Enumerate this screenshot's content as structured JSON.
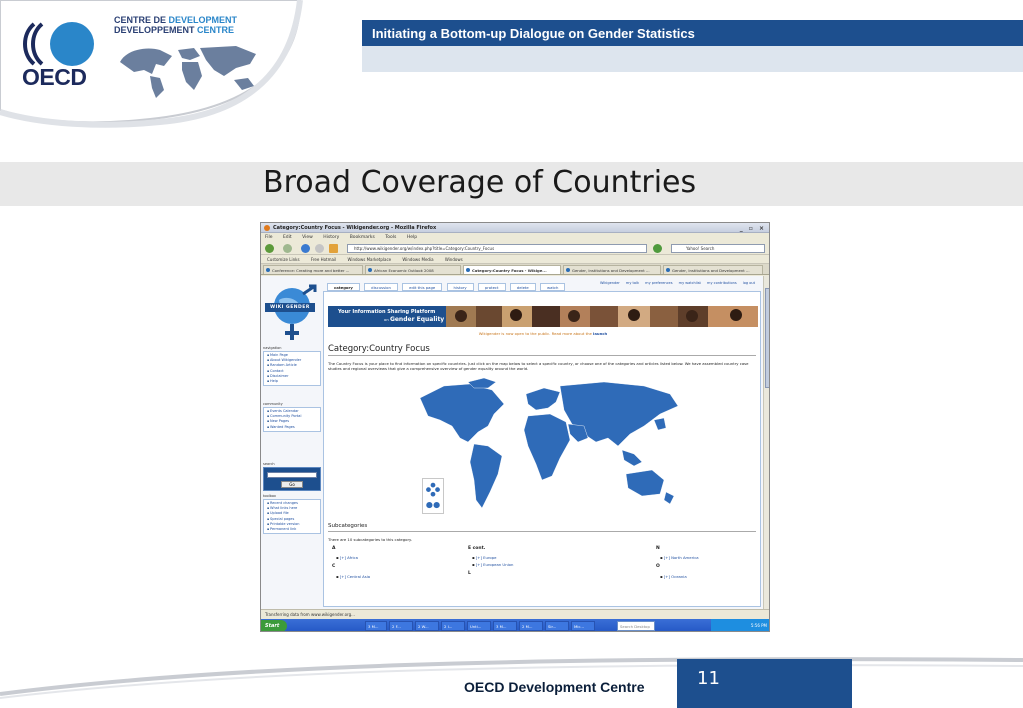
{
  "header": {
    "logo_word": "OECD",
    "centre_line1_a": "CENTRE DE ",
    "centre_line1_b": "DEVELOPMENT",
    "centre_line2_a": "DEVELOPPEMENT ",
    "centre_line2_b": "CENTRE",
    "banner_title": "Initiating a Bottom-up Dialogue on Gender Statistics"
  },
  "slide": {
    "title": "Broad Coverage of Countries"
  },
  "browser": {
    "window_title": "Category:Country Focus - Wikigender.org - Mozilla Firefox",
    "window_buttons": "_ ▫ ×",
    "menu": [
      "File",
      "Edit",
      "View",
      "History",
      "Bookmarks",
      "Tools",
      "Help"
    ],
    "url": "http://www.wikigender.org/w/index.php?title=Category:Country_Focus",
    "search_placeholder": "Yahoo! Search",
    "bookmarks": [
      "Customize Links",
      "Free Hotmail",
      "Windows Marketplace",
      "Windows Media",
      "Windows"
    ],
    "tabs": [
      "Conference: Creating more and better ...",
      "African Economic Outlook 2008",
      "Category:Country Focus - Wikige...",
      "Gender, Institutions and Development ...",
      "Gender, Institutions and Development ..."
    ],
    "status": "Transferring data from www.wikigender.org...",
    "taskbar": {
      "start": "Start",
      "items": [
        "3 M...",
        "2 F...",
        "2 W...",
        "2 I...",
        "Unti...",
        "3 M...",
        "2 M...",
        "Sir...",
        "Mic..."
      ],
      "search": "Search Desktop",
      "clock": "5:56 PM"
    }
  },
  "wiki": {
    "logo_word": "WIKI GENDER",
    "user_links": [
      "Wikigender",
      "my talk",
      "my preferences",
      "my watchlist",
      "my contributions",
      "log out"
    ],
    "content_tabs": [
      "category",
      "discussion",
      "edit this page",
      "history",
      "protect",
      "delete",
      "watch"
    ],
    "banner_line1": "Your Information Sharing Platform",
    "banner_on": "on ",
    "banner_line2": "Gender Equality",
    "notice_text": "Wikigender is now open to the public. Read more about the ",
    "notice_link": "launch",
    "heading": "Category:Country Focus",
    "intro": "The Country Focus is your place to find information on specific countries. Just click on the map below to select a specific country, or choose one of the categories and articles listed below. We have assembled country case studies and regional overviews that give a comprehensive overview of gender equality around the world.",
    "nav_title": "navigation",
    "nav_items": [
      "Main Page",
      "About Wikigender",
      "Random Article",
      "Contact",
      "Disclaimer",
      "Help"
    ],
    "community_title": "community",
    "community_items": [
      "Events Calendar",
      "Community Portal",
      "New Pages",
      "Wanted Pages"
    ],
    "search_title": "search",
    "go_label": "Go",
    "toolbox_title": "toolbox",
    "toolbox_items": [
      "Recent changes",
      "What links here",
      "Upload file",
      "Special pages",
      "Printable version",
      "Permanent link"
    ],
    "subcat_heading": "Subcategories",
    "subcat_count": "There are 10 subcategories to this category.",
    "col_a_letter": "A",
    "col_a_items": [
      "[+] Africa"
    ],
    "col_c_letter": "C",
    "col_c_items": [
      "[+] Central Asia"
    ],
    "col_e_letter": "E cont.",
    "col_e_items": [
      "[+] Europe",
      "[+] European Union"
    ],
    "col_l_letter": "L",
    "col_n_letter": "N",
    "col_n_items": [
      "[+] North America"
    ],
    "col_o_letter": "O",
    "col_o_items": [
      "[+] Oceania"
    ]
  },
  "footer": {
    "org": "OECD Development Centre",
    "page_number": "11"
  },
  "colors": {
    "brand_blue": "#1d4f8e",
    "map_blue": "#2f6bb8",
    "link_blue": "#1f4fa0"
  }
}
